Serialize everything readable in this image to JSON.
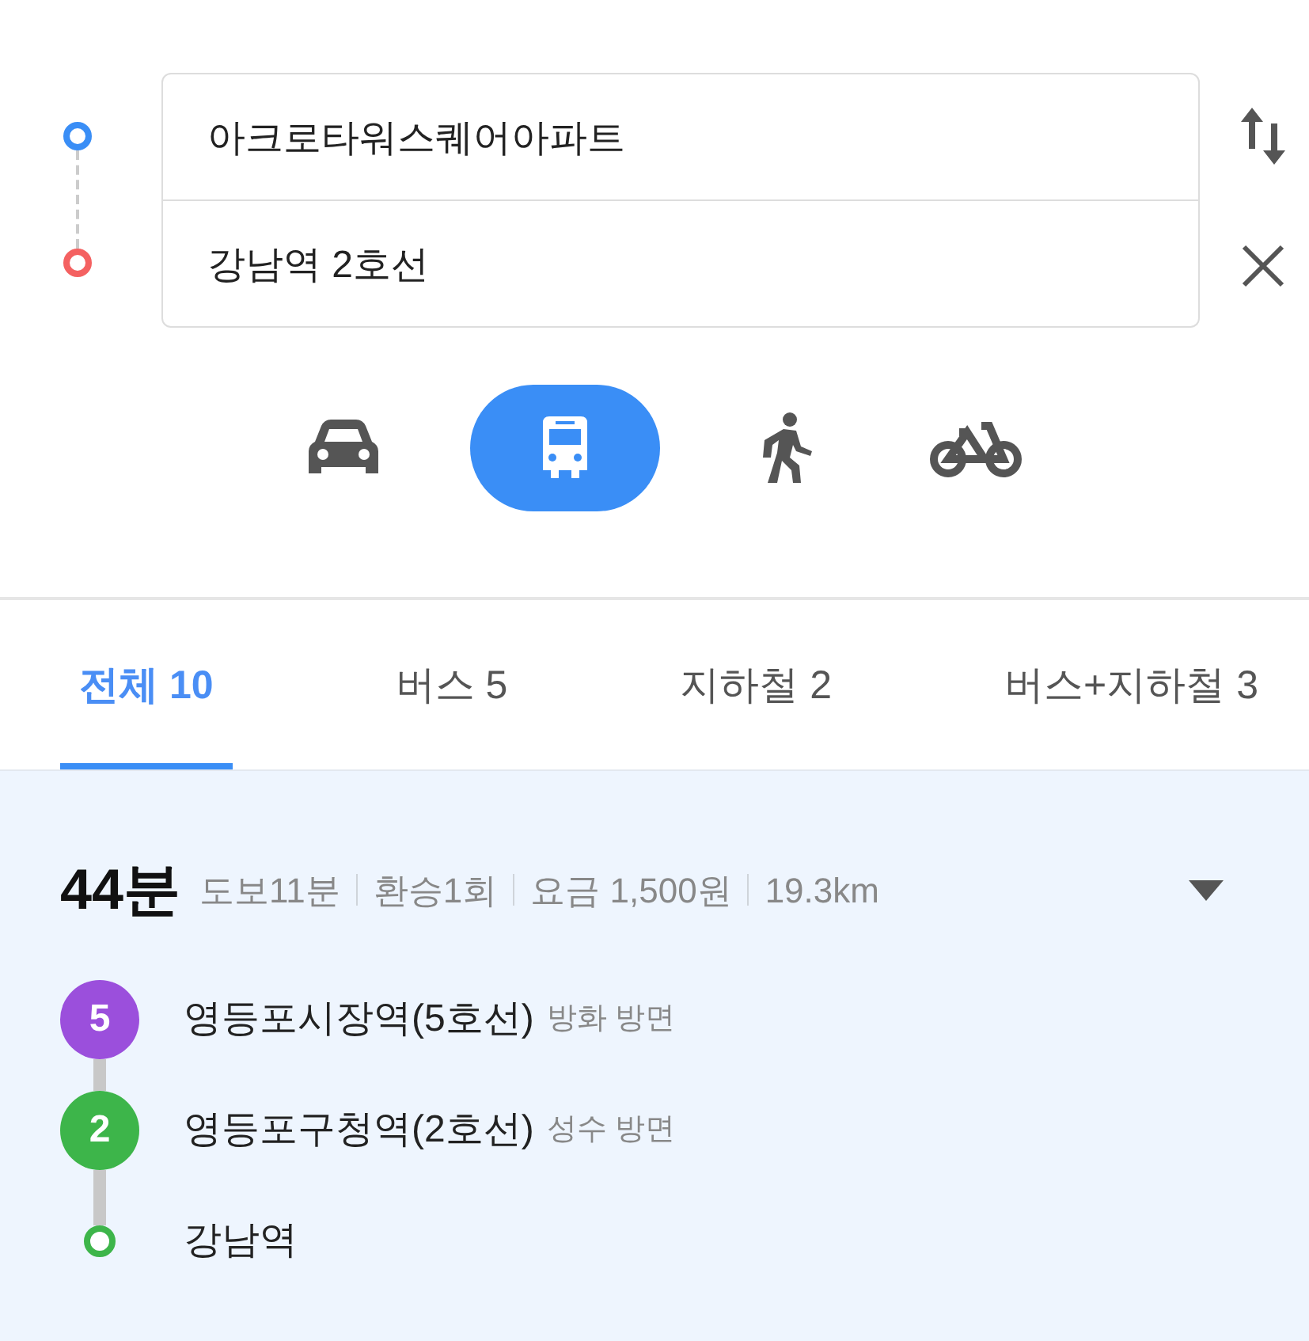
{
  "route_inputs": {
    "origin": {
      "value": "아크로타워스퀘어아파트"
    },
    "destination": {
      "value": "강남역 2호선"
    }
  },
  "modes": [
    {
      "kind": "car",
      "selected": false
    },
    {
      "kind": "bus",
      "selected": true
    },
    {
      "kind": "walk",
      "selected": false
    },
    {
      "kind": "bike",
      "selected": false
    }
  ],
  "tabs": [
    {
      "label": "전체 10",
      "selected": true
    },
    {
      "label": "버스 5",
      "selected": false
    },
    {
      "label": "지하철 2",
      "selected": false
    },
    {
      "label": "버스+지하철 3",
      "selected": false
    }
  ],
  "route": {
    "duration": "44분",
    "details": [
      "도보11분",
      "환승1회",
      "요금 1,500원",
      "19.3km"
    ],
    "expanded": false,
    "steps": [
      {
        "kind": "line",
        "badge": "5",
        "color": "#9b4fdc",
        "station": "영등포시장역(5호선)",
        "direction": "방화 방면"
      },
      {
        "kind": "line",
        "badge": "2",
        "color": "#3db54a",
        "station": "영등포구청역(2호선)",
        "direction": "성수 방면"
      },
      {
        "kind": "end",
        "color": "#3db54a",
        "station": "강남역"
      }
    ]
  }
}
